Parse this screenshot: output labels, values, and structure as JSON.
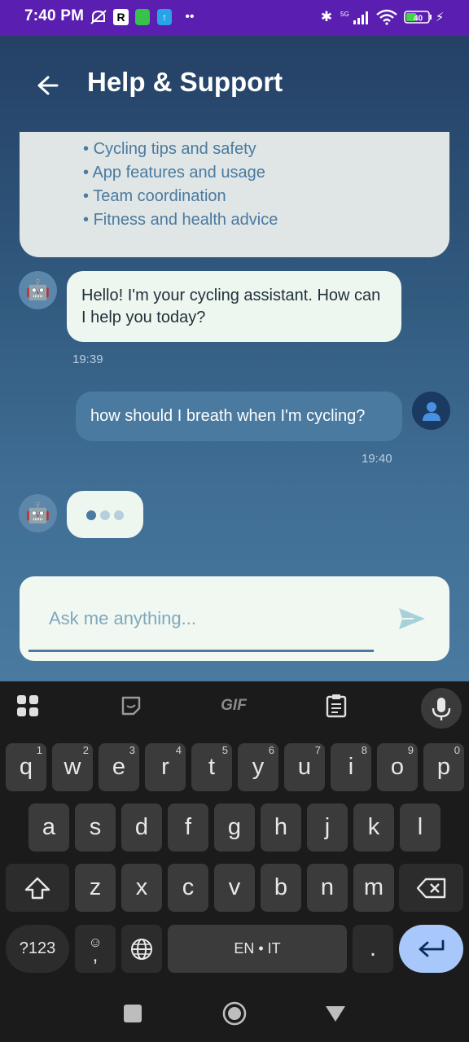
{
  "status_bar": {
    "time": "7:40 PM",
    "battery": "40",
    "network": "5G"
  },
  "header": {
    "title": "Help & Support"
  },
  "info_card": {
    "items": [
      "Cycling tips and safety",
      "App features and usage",
      "Team coordination",
      "Fitness and health advice"
    ]
  },
  "messages": [
    {
      "sender": "bot",
      "text": "Hello! I'm your cycling assistant. How can I help you today?",
      "time": "19:39"
    },
    {
      "sender": "user",
      "text": "how should I breath when I'm cycling?",
      "time": "19:40"
    }
  ],
  "input": {
    "placeholder": "Ask me anything...",
    "value": ""
  },
  "keyboard": {
    "toolbar": [
      "apps-icon",
      "sticker-icon",
      "GIF",
      "clipboard-icon",
      "mic-icon"
    ],
    "row1": [
      {
        "k": "q",
        "h": "1"
      },
      {
        "k": "w",
        "h": "2"
      },
      {
        "k": "e",
        "h": "3"
      },
      {
        "k": "r",
        "h": "4"
      },
      {
        "k": "t",
        "h": "5"
      },
      {
        "k": "y",
        "h": "6"
      },
      {
        "k": "u",
        "h": "7"
      },
      {
        "k": "i",
        "h": "8"
      },
      {
        "k": "o",
        "h": "9"
      },
      {
        "k": "p",
        "h": "0"
      }
    ],
    "row2": [
      "a",
      "s",
      "d",
      "f",
      "g",
      "h",
      "j",
      "k",
      "l"
    ],
    "row3": [
      "z",
      "x",
      "c",
      "v",
      "b",
      "n",
      "m"
    ],
    "symbols_label": "?123",
    "comma": ",",
    "space_label": "EN • IT",
    "period": "."
  },
  "colors": {
    "accent": "#4a7aa0",
    "bubble_bot": "#eef7ef",
    "status_bar": "#5a1fb0",
    "enter_key": "#a8c7fa"
  }
}
